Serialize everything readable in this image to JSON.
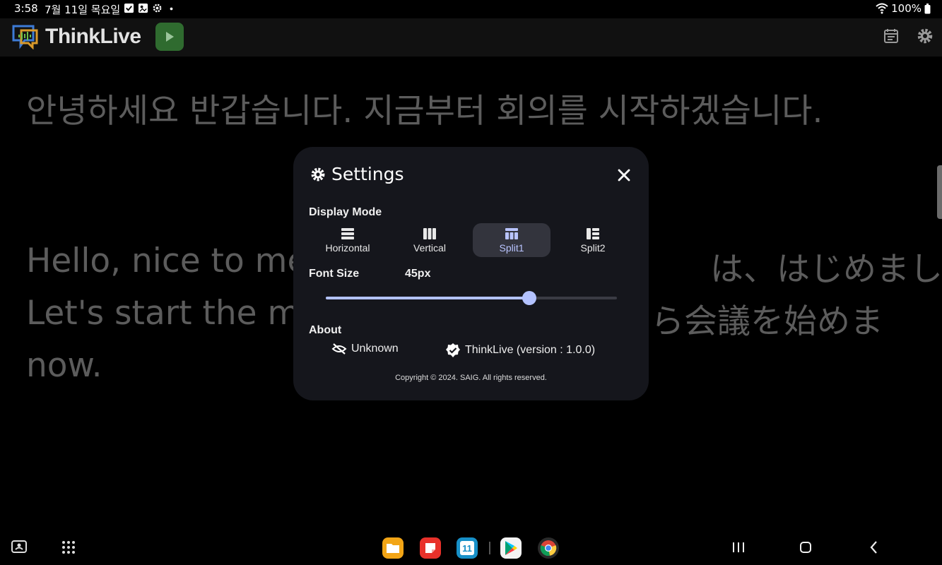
{
  "status_bar": {
    "time": "3:58",
    "date": "7월 11일 목요일",
    "battery": "100%",
    "icons": [
      "check-square-icon",
      "image-badge-icon",
      "gear-small-icon",
      "dot-icon",
      "wifi-icon",
      "battery-icon"
    ]
  },
  "app_bar": {
    "title": "ThinkLive",
    "icons": [
      "thinklive-logo-icon",
      "play-icon",
      "calendar-icon",
      "gear-icon"
    ],
    "play_button_color": "#2f6b2f"
  },
  "transcript": {
    "lines": [
      "안녕하세요 반갑습니다.  지금부터 회의를 시작하겠습니다.",
      "Hello, nice to meet you.",
      "Let's start the meeting",
      "now.",
      "は、はじめまし",
      "ら会議を始めま"
    ]
  },
  "settings": {
    "title": "Settings",
    "display_mode_label": "Display Mode",
    "modes": [
      {
        "label": "Horizontal",
        "icon": "rows-icon",
        "selected": false
      },
      {
        "label": "Vertical",
        "icon": "columns-icon",
        "selected": false
      },
      {
        "label": "Split1",
        "icon": "split1-icon",
        "selected": true
      },
      {
        "label": "Split2",
        "icon": "split2-icon",
        "selected": false
      }
    ],
    "font_size_label": "Font Size",
    "font_size_value": "45px",
    "font_size_slider_fraction": 0.698,
    "about_label": "About",
    "about_unknown": "Unknown",
    "about_version": "ThinkLive (version : 1.0.0)",
    "copyright": "Copyright © 2024. SAIG. All rights reserved.",
    "accent_color": "#b3c2ff",
    "dialog_bg": "#15161c"
  },
  "taskbar": {
    "icons": [
      "screen-capture-icon",
      "app-grid-icon",
      "my-files-icon",
      "notes-icon",
      "calendar-app-icon",
      "play-store-icon",
      "chrome-icon",
      "recents-icon",
      "home-icon",
      "back-icon"
    ],
    "calendar_day": "11"
  }
}
